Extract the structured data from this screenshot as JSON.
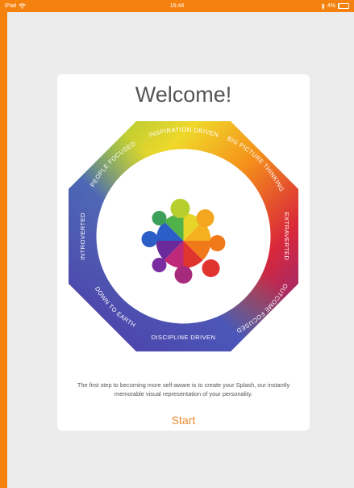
{
  "status_bar": {
    "device": "iPad",
    "time": "16:44",
    "battery": "4%"
  },
  "card": {
    "title": "Welcome!",
    "traits": {
      "top": "INSPIRATION DRIVEN",
      "top_right": "BIG PICTURE THINKING",
      "right": "EXTRAVERTED",
      "bottom_right": "OUTCOME FOCUSED",
      "bottom": "DISCIPLINE DRIVEN",
      "bottom_left": "DOWN TO EARTH",
      "left": "INTROVERTED",
      "top_left": "PEOPLE FOCUSED"
    },
    "description": "The first step to becoming more self-aware is to create your Splash, our instantly memorable visual representation of your personality.",
    "start_label": "Start"
  },
  "colors": {
    "accent": "#f5820e",
    "start": "#ee8b2f",
    "background": "#ececec"
  }
}
